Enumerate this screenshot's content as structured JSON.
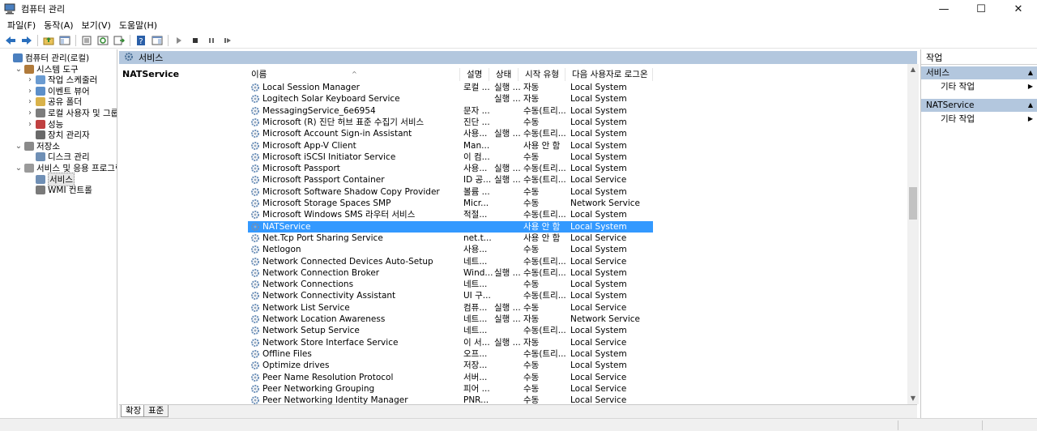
{
  "window": {
    "title": "컴퓨터 관리",
    "minimize": "—",
    "maximize": "☐",
    "close": "✕"
  },
  "menu": [
    "파일(F)",
    "동작(A)",
    "보기(V)",
    "도움말(H)"
  ],
  "tree": [
    {
      "label": "컴퓨터 관리(로컬)",
      "level": 0,
      "expander": "",
      "icon": "computer-icon"
    },
    {
      "label": "시스템 도구",
      "level": 1,
      "expander": "v",
      "icon": "tools-icon"
    },
    {
      "label": "작업 스케줄러",
      "level": 2,
      "expander": ">",
      "icon": "clock-icon"
    },
    {
      "label": "이벤트 뷰어",
      "level": 2,
      "expander": ">",
      "icon": "event-viewer-icon"
    },
    {
      "label": "공유 폴더",
      "level": 2,
      "expander": ">",
      "icon": "shared-folder-icon"
    },
    {
      "label": "로컬 사용자 및 그룹",
      "level": 2,
      "expander": ">",
      "icon": "users-icon"
    },
    {
      "label": "성능",
      "level": 2,
      "expander": ">",
      "icon": "performance-icon"
    },
    {
      "label": "장치 관리자",
      "level": 2,
      "expander": "",
      "icon": "device-manager-icon"
    },
    {
      "label": "저장소",
      "level": 1,
      "expander": "v",
      "icon": "storage-icon"
    },
    {
      "label": "디스크 관리",
      "level": 2,
      "expander": "",
      "icon": "disk-icon"
    },
    {
      "label": "서비스 및 응용 프로그램",
      "level": 1,
      "expander": "v",
      "icon": "services-apps-icon"
    },
    {
      "label": "서비스",
      "level": 2,
      "expander": "",
      "icon": "gear-icon",
      "selected": true
    },
    {
      "label": "WMI 컨트롤",
      "level": 2,
      "expander": "",
      "icon": "wmi-icon"
    }
  ],
  "header": {
    "title": "서비스"
  },
  "detail": {
    "selected_name": "NATService"
  },
  "columns": {
    "name": "이름",
    "desc": "설명",
    "state": "상태",
    "start": "시작 유형",
    "logon": "다음 사용자로 로그온"
  },
  "services": [
    {
      "name": "Local Session Manager",
      "desc": "로컬 ...",
      "state": "실행 ...",
      "start": "자동",
      "logon": "Local System"
    },
    {
      "name": "Logitech Solar Keyboard Service",
      "desc": "",
      "state": "실행 ...",
      "start": "자동",
      "logon": "Local System"
    },
    {
      "name": "MessagingService_6e6954",
      "desc": "문자 ...",
      "state": "",
      "start": "수동(트리...",
      "logon": "Local System"
    },
    {
      "name": "Microsoft (R) 진단 허브 표준 수집기 서비스",
      "desc": "진단 ...",
      "state": "",
      "start": "수동",
      "logon": "Local System"
    },
    {
      "name": "Microsoft Account Sign-in Assistant",
      "desc": "사용...",
      "state": "실행 ...",
      "start": "수동(트리...",
      "logon": "Local System"
    },
    {
      "name": "Microsoft App-V Client",
      "desc": "Man...",
      "state": "",
      "start": "사용 안 함",
      "logon": "Local System"
    },
    {
      "name": "Microsoft iSCSI Initiator Service",
      "desc": "이 컴...",
      "state": "",
      "start": "수동",
      "logon": "Local System"
    },
    {
      "name": "Microsoft Passport",
      "desc": "사용...",
      "state": "실행 ...",
      "start": "수동(트리...",
      "logon": "Local System"
    },
    {
      "name": "Microsoft Passport Container",
      "desc": "ID 공...",
      "state": "실행 ...",
      "start": "수동(트리...",
      "logon": "Local Service"
    },
    {
      "name": "Microsoft Software Shadow Copy Provider",
      "desc": "볼륨 ...",
      "state": "",
      "start": "수동",
      "logon": "Local System"
    },
    {
      "name": "Microsoft Storage Spaces SMP",
      "desc": "Micr...",
      "state": "",
      "start": "수동",
      "logon": "Network Service"
    },
    {
      "name": "Microsoft Windows SMS 라우터 서비스",
      "desc": "적절...",
      "state": "",
      "start": "수동(트리...",
      "logon": "Local System"
    },
    {
      "name": "NATService",
      "desc": "",
      "state": "",
      "start": "사용 안 함",
      "logon": "Local System",
      "selected": true
    },
    {
      "name": "Net.Tcp Port Sharing Service",
      "desc": "net.t...",
      "state": "",
      "start": "사용 안 함",
      "logon": "Local Service"
    },
    {
      "name": "Netlogon",
      "desc": "사용...",
      "state": "",
      "start": "수동",
      "logon": "Local System"
    },
    {
      "name": "Network Connected Devices Auto-Setup",
      "desc": "네트...",
      "state": "",
      "start": "수동(트리...",
      "logon": "Local Service"
    },
    {
      "name": "Network Connection Broker",
      "desc": "Wind...",
      "state": "실행 ...",
      "start": "수동(트리...",
      "logon": "Local System"
    },
    {
      "name": "Network Connections",
      "desc": "네트...",
      "state": "",
      "start": "수동",
      "logon": "Local System"
    },
    {
      "name": "Network Connectivity Assistant",
      "desc": "UI 구...",
      "state": "",
      "start": "수동(트리...",
      "logon": "Local System"
    },
    {
      "name": "Network List Service",
      "desc": "컴퓨...",
      "state": "실행 ...",
      "start": "수동",
      "logon": "Local Service"
    },
    {
      "name": "Network Location Awareness",
      "desc": "네트...",
      "state": "실행 ...",
      "start": "자동",
      "logon": "Network Service"
    },
    {
      "name": "Network Setup Service",
      "desc": "네트...",
      "state": "",
      "start": "수동(트리...",
      "logon": "Local System"
    },
    {
      "name": "Network Store Interface Service",
      "desc": "이 서...",
      "state": "실행 ...",
      "start": "자동",
      "logon": "Local Service"
    },
    {
      "name": "Offline Files",
      "desc": "오프...",
      "state": "",
      "start": "수동(트리...",
      "logon": "Local System"
    },
    {
      "name": "Optimize drives",
      "desc": "저장...",
      "state": "",
      "start": "수동",
      "logon": "Local System"
    },
    {
      "name": "Peer Name Resolution Protocol",
      "desc": "서버...",
      "state": "",
      "start": "수동",
      "logon": "Local Service"
    },
    {
      "name": "Peer Networking Grouping",
      "desc": "피어 ...",
      "state": "",
      "start": "수동",
      "logon": "Local Service"
    },
    {
      "name": "Peer Networking Identity Manager",
      "desc": "PNR...",
      "state": "",
      "start": "수동",
      "logon": "Local Service"
    }
  ],
  "tabs": [
    "확장",
    "표준"
  ],
  "actions": {
    "title": "작업",
    "sections": [
      {
        "label": "서비스",
        "item": "기타 작업"
      },
      {
        "label": "NATService",
        "item": "기타 작업"
      }
    ]
  },
  "colors": {
    "header_blue": "#b3c7de",
    "selection": "#3399ff"
  }
}
